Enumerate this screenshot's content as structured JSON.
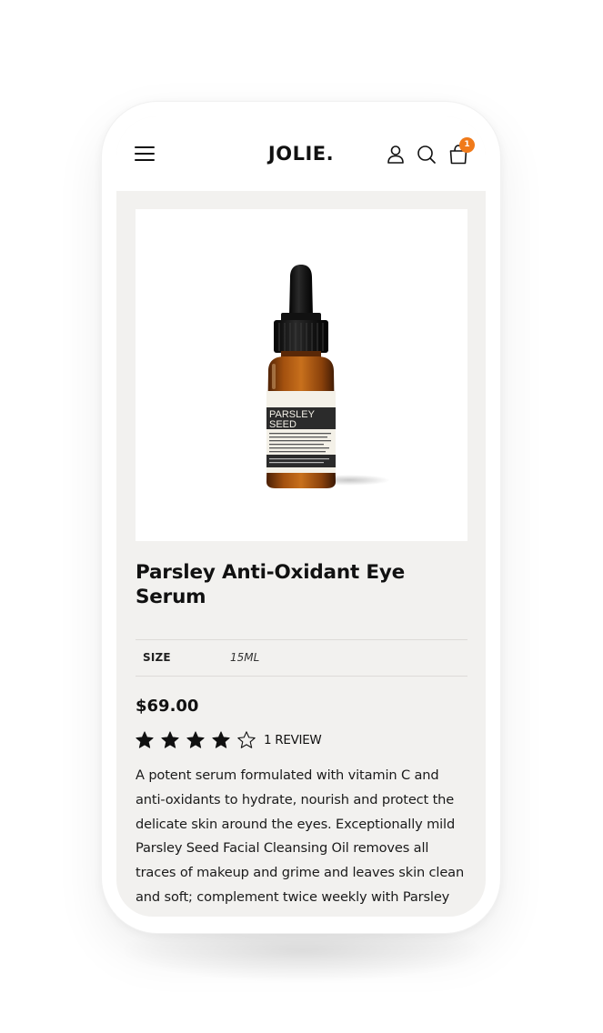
{
  "brand": {
    "logo_text": "JOLIE.",
    "accent_color": "#f07a1a"
  },
  "header": {
    "menu_icon": "hamburger-menu-icon",
    "account_icon": "user-icon",
    "search_icon": "search-icon",
    "cart_icon": "shopping-bag-icon",
    "cart_count": "1"
  },
  "product": {
    "image_label_line1": "PARSLEY",
    "image_label_line2": "SEED",
    "title": "Parsley Anti-Oxidant Eye Serum",
    "size_label": "SIZE",
    "size_value": "15ML",
    "price": "$69.00",
    "rating": 4,
    "rating_max": 5,
    "reviews_text": "1 REVIEW",
    "description": "A potent serum formulated with vitamin C and anti-oxidants to hydrate, nourish and protect the delicate skin around the eyes. Exceptionally mild Parsley Seed Facial Cleansing Oil removes all traces of makeup and grime and leaves skin clean and soft; complement twice weekly with Parsley"
  }
}
